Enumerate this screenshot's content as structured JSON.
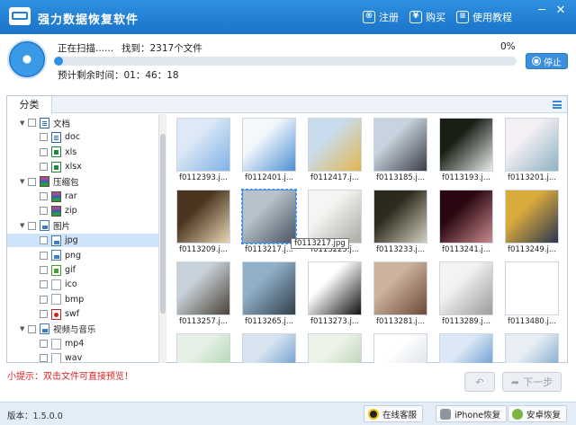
{
  "titlebar": {
    "app_name": "强力数据恢复软件",
    "register_label": "注册",
    "buy_label": "购买",
    "tutorial_label": "使用教程",
    "minimize_glyph": "─",
    "close_glyph": "✕"
  },
  "scan": {
    "status_text": "正在扫描......",
    "found_text": "找到：2317个文件",
    "percent_text": "0%",
    "progress_percent": 2,
    "remaining_text": "预计剩余时间：01：46：18",
    "stop_label": "停止"
  },
  "panel": {
    "tab_label": "分类"
  },
  "tree": {
    "items": [
      {
        "label": "文档",
        "level": 0,
        "icon": "doc-icon",
        "expanded": true
      },
      {
        "label": "doc",
        "level": 1,
        "icon": "word-icon"
      },
      {
        "label": "xls",
        "level": 1,
        "icon": "excel-icon"
      },
      {
        "label": "xlsx",
        "level": 1,
        "icon": "excel-icon"
      },
      {
        "label": "压缩包",
        "level": 0,
        "icon": "archive-icon",
        "expanded": true
      },
      {
        "label": "rar",
        "level": 1,
        "icon": "archive-icon"
      },
      {
        "label": "zip",
        "level": 1,
        "icon": "archive-icon"
      },
      {
        "label": "图片",
        "level": 0,
        "icon": "image-icon",
        "expanded": true
      },
      {
        "label": "jpg",
        "level": 1,
        "icon": "image-icon",
        "selected": true
      },
      {
        "label": "png",
        "level": 1,
        "icon": "image-icon"
      },
      {
        "label": "gif",
        "level": 1,
        "icon": "gif-icon"
      },
      {
        "label": "ico",
        "level": 1,
        "icon": "file-icon"
      },
      {
        "label": "bmp",
        "level": 1,
        "icon": "file-icon"
      },
      {
        "label": "swf",
        "level": 1,
        "icon": "pdf-icon"
      },
      {
        "label": "视频与音乐",
        "level": 0,
        "icon": "image-icon",
        "expanded": true
      },
      {
        "label": "mp4",
        "level": 1,
        "icon": "file-icon"
      },
      {
        "label": "wav",
        "level": 1,
        "icon": "file-icon"
      }
    ]
  },
  "files": [
    {
      "name": "f0112393.j...",
      "colors": [
        "#dde9f6",
        "#7fb1e6"
      ]
    },
    {
      "name": "f0112401.j...",
      "colors": [
        "#f4f8fb",
        "#4e8fd3"
      ]
    },
    {
      "name": "f0112417.j...",
      "colors": [
        "#c9dcee",
        "#e3b64f"
      ]
    },
    {
      "name": "f0113185.j...",
      "colors": [
        "#c7d3de",
        "#3b3d48"
      ]
    },
    {
      "name": "f0113193.j...",
      "colors": [
        "#1a1f16",
        "#e8ece8"
      ]
    },
    {
      "name": "f0113201.j...",
      "colors": [
        "#f4eff3",
        "#8fb2c4"
      ]
    },
    {
      "name": "f0113209.j...",
      "colors": [
        "#4a3520",
        "#e8d6b5"
      ]
    },
    {
      "name": "f0113217.j...",
      "colors": [
        "#b8c2cc",
        "#4b5562"
      ],
      "selected": true
    },
    {
      "name": "f0113225.j...",
      "colors": [
        "#f5f5f3",
        "#aaa9a2"
      ]
    },
    {
      "name": "f0113233.j...",
      "colors": [
        "#2d2a1d",
        "#d3d0c0"
      ]
    },
    {
      "name": "f0113241.j...",
      "colors": [
        "#2a0710",
        "#c98a8c"
      ]
    },
    {
      "name": "f0113249.j...",
      "colors": [
        "#d9ab3c",
        "#2c3550"
      ]
    },
    {
      "name": "f0113257.j...",
      "colors": [
        "#c7d1d9",
        "#4b4236"
      ]
    },
    {
      "name": "f0113265.j...",
      "colors": [
        "#8fb0c8",
        "#333e4a"
      ]
    },
    {
      "name": "f0113273.j...",
      "colors": [
        "#ffffff",
        "#111111"
      ]
    },
    {
      "name": "f0113281.j...",
      "colors": [
        "#cdb29d",
        "#6b4a38"
      ]
    },
    {
      "name": "f0113289.j...",
      "colors": [
        "#f3f3f3",
        "#9c9c9c"
      ]
    },
    {
      "name": "f0113480.j...",
      "colors": [
        "#ffffff",
        "#ffffff"
      ]
    },
    {
      "name": "",
      "colors": [
        "#e6f0e6",
        "#9ccf9c"
      ]
    },
    {
      "name": "",
      "colors": [
        "#d9e4f0",
        "#4a85c0"
      ]
    },
    {
      "name": "",
      "colors": [
        "#eef3ea",
        "#a8c8a2"
      ]
    },
    {
      "name": "",
      "colors": [
        "#ffffff",
        "#cfd8e0"
      ]
    },
    {
      "name": "",
      "colors": [
        "#dce8f5",
        "#3f7fc5"
      ]
    },
    {
      "name": "",
      "colors": [
        "#e8eef4",
        "#5b8fc0"
      ]
    }
  ],
  "tooltip": "f0113217.jpg",
  "tip_text": "小提示：双击文件可直接预览！",
  "nav": {
    "back_glyph": "↶",
    "next_label": "下一步"
  },
  "statusbar": {
    "version_text": "版本：1.5.0.0",
    "online_service": "在线客服",
    "iphone_recovery": "iPhone恢复",
    "android_recovery": "安卓恢复"
  }
}
